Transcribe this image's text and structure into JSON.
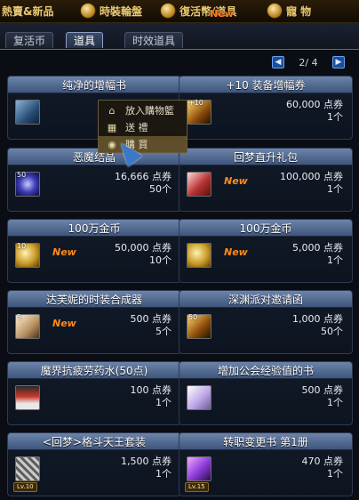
{
  "top_nav": {
    "items": [
      {
        "label": "熱賣&新品",
        "icon": "flame-icon"
      },
      {
        "label": "時裝輪盤",
        "icon": "wheel-icon"
      },
      {
        "label": "復活幣/道具",
        "icon": "coin-icon"
      },
      {
        "label": "寵 物",
        "icon": "paw-icon"
      }
    ],
    "new_badge": "New"
  },
  "tabs": [
    {
      "label": "复活币"
    },
    {
      "label": "道具"
    },
    {
      "label": "时效道具"
    }
  ],
  "active_tab": "道具",
  "pager": {
    "text": "2/ 4",
    "prev": "◀",
    "next": "▶"
  },
  "context_menu": {
    "items": [
      {
        "label": "放入購物籃",
        "icon": "basket-icon",
        "glyph": "⌂"
      },
      {
        "label": "送 禮",
        "icon": "gift-icon",
        "glyph": "▦"
      },
      {
        "label": "購 買",
        "icon": "coin-icon",
        "glyph": "◉"
      }
    ]
  },
  "items": [
    {
      "name": "纯净的增幅书",
      "price": "",
      "count": "",
      "qty": "",
      "level": "",
      "new": "",
      "icon": "book-icon"
    },
    {
      "name": "+10 装备增幅券",
      "price": "60,000 点券",
      "count": "1个",
      "qty": "+10",
      "level": "",
      "new": "",
      "icon": "ticket-icon"
    },
    {
      "name": "恶魔结晶",
      "price": "16,666 点券",
      "count": "50个",
      "qty": "50",
      "level": "",
      "new": "",
      "icon": "gem-icon"
    },
    {
      "name": "回梦直升礼包",
      "price": "100,000 点券",
      "count": "1个",
      "qty": "",
      "level": "",
      "new": "New",
      "icon": "gift-icon"
    },
    {
      "name": "100万金币",
      "price": "50,000 点券",
      "count": "10个",
      "qty": "10",
      "level": "",
      "new": "New",
      "icon": "gold-coin-icon"
    },
    {
      "name": "100万金币",
      "price": "5,000 点券",
      "count": "1个",
      "qty": "",
      "level": "",
      "new": "New",
      "icon": "gold-coin-icon"
    },
    {
      "name": "达芙妮的时装合成器",
      "price": "500 点券",
      "count": "5个",
      "qty": "5",
      "level": "",
      "new": "New",
      "icon": "scroll-icon"
    },
    {
      "name": "深渊派对邀请函",
      "price": "1,000 点券",
      "count": "50个",
      "qty": "50",
      "level": "",
      "new": "",
      "icon": "invitation-icon"
    },
    {
      "name": "魔界抗疲劳药水(50点)",
      "price": "100 点券",
      "count": "1个",
      "qty": "",
      "level": "",
      "new": "",
      "icon": "potion-icon"
    },
    {
      "name": "增加公会经验值的书",
      "price": "500 点券",
      "count": "1个",
      "qty": "",
      "level": "",
      "new": "",
      "icon": "card-icon"
    },
    {
      "name": "<回梦>格斗天王套装",
      "price": "1,500 点券",
      "count": "1个",
      "qty": "",
      "level": "Lv.10",
      "new": "",
      "icon": "box-icon"
    },
    {
      "name": "转职变更书 第1册",
      "price": "470 点券",
      "count": "1个",
      "qty": "",
      "level": "Lv.15",
      "new": "",
      "icon": "tome-icon"
    }
  ]
}
